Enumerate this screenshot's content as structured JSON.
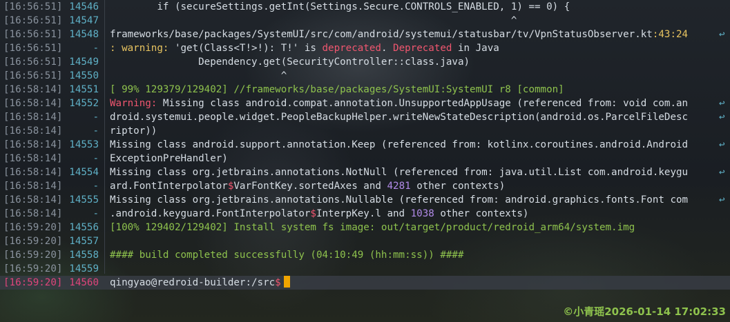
{
  "palette": {
    "text": "#d6dde4",
    "timestamp": "#8a939e",
    "line_number": "#5fb0c6",
    "current_line": "#e0457b",
    "red": "#f0566f",
    "green": "#8ec24d",
    "purple": "#b18ae8",
    "yellow": "#e8c460",
    "cursor": "#f0a500"
  },
  "lines": [
    {
      "ts": "[16:56:51]",
      "n": "14546",
      "segs": [
        {
          "t": "        if (secureSettings.getInt(Settings.Secure.CONTROLS_ENABLED, 1) == 0) {",
          "c": "text"
        }
      ]
    },
    {
      "ts": "[16:56:51]",
      "n": "14547",
      "segs": [
        {
          "t": "                                                                    ^",
          "c": "text"
        }
      ]
    },
    {
      "ts": "[16:56:51]",
      "n": "14548",
      "segs": [
        {
          "t": "frameworks/base/packages/SystemUI/src/com/android/systemui/statusbar/tv/VpnStatusObserver.kt",
          "c": "text"
        },
        {
          "t": ":43:24",
          "c": "yellow"
        }
      ],
      "wrap": true
    },
    {
      "ts": "[16:56:51]",
      "n": "-",
      "segs": [
        {
          "t": ": warning: ",
          "c": "yellow"
        },
        {
          "t": "'get(Class<T!>!): T!'",
          "c": "text"
        },
        {
          "t": " is ",
          "c": "text"
        },
        {
          "t": "deprecated",
          "c": "red"
        },
        {
          "t": ". ",
          "c": "text"
        },
        {
          "t": "Deprecated",
          "c": "red"
        },
        {
          "t": " in Java",
          "c": "text"
        }
      ]
    },
    {
      "ts": "[16:56:51]",
      "n": "14549",
      "segs": [
        {
          "t": "               Dependency.get(SecurityController::class.java)",
          "c": "text"
        }
      ]
    },
    {
      "ts": "[16:56:51]",
      "n": "14550",
      "segs": [
        {
          "t": "                             ^",
          "c": "text"
        }
      ]
    },
    {
      "ts": "[16:58:14]",
      "n": "14551",
      "segs": [
        {
          "t": "[ 99% 129379/129402] //frameworks/base/packages/SystemUI:SystemUI r8 [common]",
          "c": "green"
        }
      ]
    },
    {
      "ts": "[16:58:14]",
      "n": "14552",
      "segs": [
        {
          "t": "Warning: ",
          "c": "red"
        },
        {
          "t": "Missing class android.compat.annotation.UnsupportedAppUsage (referenced from: void com.an",
          "c": "text"
        }
      ],
      "wrap": true
    },
    {
      "ts": "[16:58:14]",
      "n": "-",
      "segs": [
        {
          "t": "droid.systemui.people.widget.PeopleBackupHelper.writeNewStateDescription(android.os.ParcelFileDesc",
          "c": "text"
        }
      ],
      "wrap": true
    },
    {
      "ts": "[16:58:14]",
      "n": "-",
      "segs": [
        {
          "t": "riptor))",
          "c": "text"
        }
      ]
    },
    {
      "ts": "[16:58:14]",
      "n": "14553",
      "segs": [
        {
          "t": "Missing class android.support.annotation.Keep (referenced from: kotlinx.coroutines.android.Android",
          "c": "text"
        }
      ],
      "wrap": true
    },
    {
      "ts": "[16:58:14]",
      "n": "-",
      "segs": [
        {
          "t": "ExceptionPreHandler)",
          "c": "text"
        }
      ]
    },
    {
      "ts": "[16:58:14]",
      "n": "14554",
      "segs": [
        {
          "t": "Missing class org.jetbrains.annotations.NotNull (referenced from: java.util.List com.android.keygu",
          "c": "text"
        }
      ],
      "wrap": true
    },
    {
      "ts": "[16:58:14]",
      "n": "-",
      "segs": [
        {
          "t": "ard.FontInterpolator",
          "c": "text"
        },
        {
          "t": "$",
          "c": "red"
        },
        {
          "t": "VarFontKey.sortedAxes and ",
          "c": "text"
        },
        {
          "t": "4281",
          "c": "purple"
        },
        {
          "t": " other contexts)",
          "c": "text"
        }
      ]
    },
    {
      "ts": "[16:58:14]",
      "n": "14555",
      "segs": [
        {
          "t": "Missing class org.jetbrains.annotations.Nullable (referenced from: android.graphics.fonts.Font com",
          "c": "text"
        }
      ],
      "wrap": true
    },
    {
      "ts": "[16:58:14]",
      "n": "-",
      "segs": [
        {
          "t": ".android.keyguard.FontInterpolator",
          "c": "text"
        },
        {
          "t": "$",
          "c": "red"
        },
        {
          "t": "InterpKey.l and ",
          "c": "text"
        },
        {
          "t": "1038",
          "c": "purple"
        },
        {
          "t": " other contexts)",
          "c": "text"
        }
      ]
    },
    {
      "ts": "[16:59:20]",
      "n": "14556",
      "segs": [
        {
          "t": "[100% 129402/129402] Install system fs image: out/target/product/redroid_arm64/system.img",
          "c": "green"
        }
      ]
    },
    {
      "ts": "[16:59:20]",
      "n": "14557",
      "segs": []
    },
    {
      "ts": "[16:59:20]",
      "n": "14558",
      "segs": [
        {
          "t": "#### build completed successfully (04:10:49 (hh:mm:ss)) ####",
          "c": "green"
        }
      ]
    },
    {
      "ts": "[16:59:20]",
      "n": "14559",
      "segs": []
    },
    {
      "ts": "[16:59:20]",
      "n": "14560",
      "segs": [
        {
          "t": "qingyao@redroid-builder:/src",
          "c": "text"
        },
        {
          "t": "$",
          "c": "red"
        }
      ],
      "current": true,
      "cursor": true
    }
  ],
  "watermark": "©小青瑶2026-01-14 17:02:33"
}
